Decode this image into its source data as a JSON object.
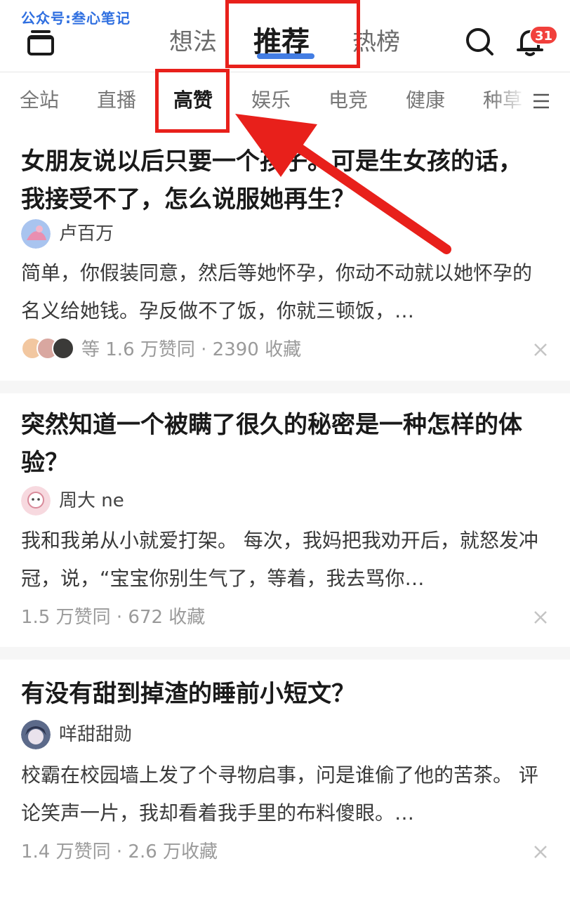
{
  "watermark": "公众号:叁心笔记",
  "header": {
    "tabs": [
      {
        "label": "想法",
        "active": false
      },
      {
        "label": "推荐",
        "active": true
      },
      {
        "label": "热榜",
        "active": false
      }
    ],
    "notification_count": "31",
    "accent_color": "#2f6fe0",
    "badge_color": "#f1403c"
  },
  "categories": {
    "items": [
      {
        "label": "全站",
        "active": false
      },
      {
        "label": "直播",
        "active": false
      },
      {
        "label": "高赞",
        "active": true
      },
      {
        "label": "娱乐",
        "active": false
      },
      {
        "label": "电竞",
        "active": false
      },
      {
        "label": "健康",
        "active": false
      },
      {
        "label": "种草",
        "active": false
      }
    ]
  },
  "feed": [
    {
      "title": "女朋友说以后只要一个孩子。可是生女孩的话，我接受不了，怎么说服她再生？",
      "author": "卢百万",
      "excerpt": "简单，你假装同意，然后等她怀孕，你动不动就以她怀孕的名义给她钱。孕反做不了饭，你就三顿饭，…",
      "meta": "等 1.6 万赞同 · 2390 收藏"
    },
    {
      "title": "突然知道一个被瞒了很久的秘密是一种怎样的体验？",
      "author": "周大 ne",
      "excerpt": "我和我弟从小就爱打架。 每次，我妈把我劝开后，就怒发冲冠，说，“宝宝你别生气了，等着，我去骂你…",
      "meta": "1.5 万赞同 · 672 收藏"
    },
    {
      "title": "有没有甜到掉渣的睡前小短文？",
      "author": "咩甜甜勋",
      "excerpt": "校霸在校园墙上发了个寻物启事，问是谁偷了他的苦茶。 评论笑声一片，我却看着我手里的布料傻眼。…",
      "meta": "1.4 万赞同 · 2.6 万收藏"
    }
  ],
  "annotation_color": "#e8201b"
}
